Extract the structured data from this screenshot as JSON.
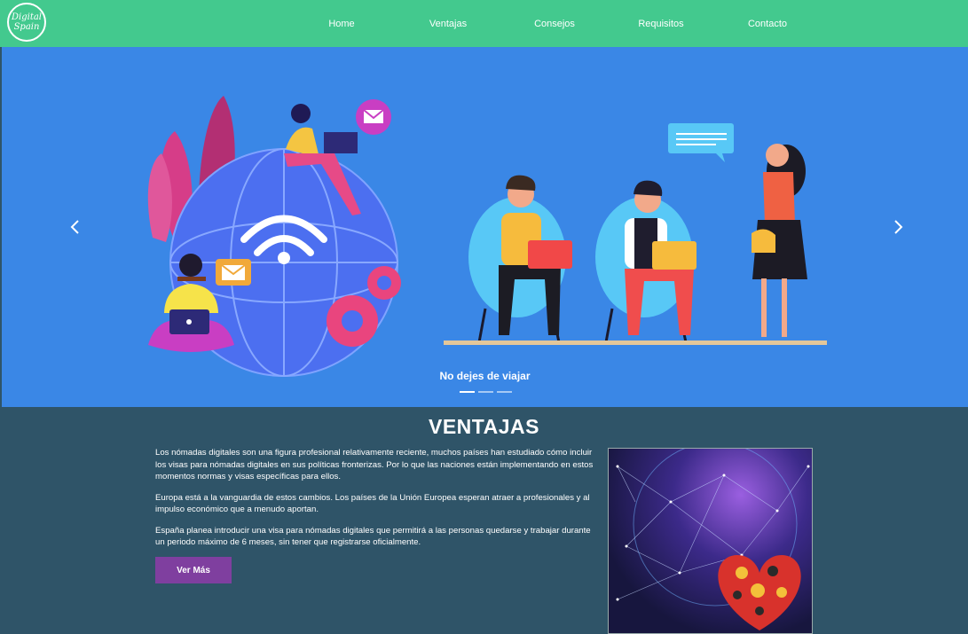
{
  "nav": {
    "logo_line1": "Digital",
    "logo_line2": "Spain",
    "links": [
      "Home",
      "Ventajas",
      "Consejos",
      "Requisitos",
      "Contacto"
    ]
  },
  "hero": {
    "caption": "No dejes de viajar",
    "slide_count": 3,
    "active_slide": 1
  },
  "ventajas": {
    "title": "VENTAJAS",
    "paragraphs": [
      "Los nómadas digitales son una figura profesional relativamente reciente, muchos países han estudiado cómo incluir los visas para nómadas digitales en sus políticas fronterizas. Por lo que las naciones están implementando en estos momentos normas y visas específicas para ellos.",
      "Europa está a la vanguardia de estos cambios. Los países de la Unión Europea esperan atraer a profesionales y al impulso económico que a menudo aportan.",
      "España planea introducir una visa para nómadas digitales que permitirá a las personas quedarse y trabajar durante un periodo máximo de 6 meses, sin tener que registrarse oficialmente."
    ],
    "button_label": "Ver Más"
  },
  "colors": {
    "nav_bg": "#43c98e",
    "hero_bg": "#3a87e6",
    "section_bg": "#2f5468",
    "button_bg": "#7f3f9f"
  },
  "icons": {
    "prev": "chevron-left-icon",
    "next": "chevron-right-icon"
  }
}
